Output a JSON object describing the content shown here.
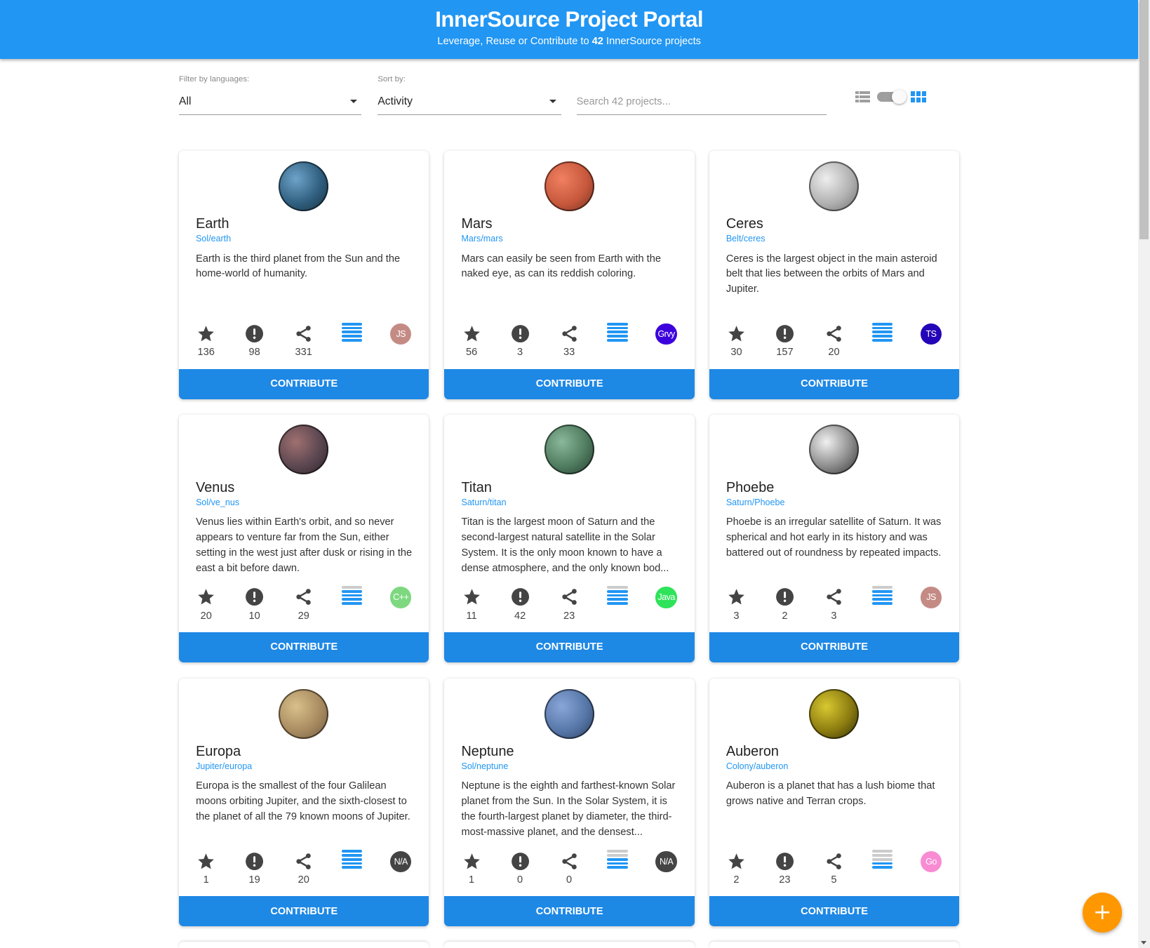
{
  "header": {
    "title": "InnerSource Project Portal",
    "subtitle_pre": "Leverage, Reuse or Contribute to ",
    "subtitle_count": "42",
    "subtitle_post": " InnerSource projects"
  },
  "filters": {
    "language_label": "Filter by languages:",
    "language_value": "All",
    "sort_label": "Sort by:",
    "sort_value": "Activity",
    "search_placeholder": "Search 42 projects..."
  },
  "view_toggle": {
    "list_icon": "list-view-icon",
    "grid_icon": "grid-view-icon",
    "grid_selected": true
  },
  "contribute_label": "CONTRIBUTE",
  "fab_label": "+",
  "colors": {
    "header": "#2196f3",
    "button": "#1e88e5",
    "fab": "#ff9800"
  },
  "projects": [
    {
      "name": "Earth",
      "repo": "Sol/earth",
      "description": "Earth is the third planet from the Sun and the home-world of humanity.",
      "stars": "136",
      "issues": "98",
      "forks": "331",
      "activity": 5,
      "language": "JS",
      "lang_color": "#c48b84",
      "planet": [
        "#6ea3c9",
        "#2f5e7e",
        "#1a2f3a"
      ]
    },
    {
      "name": "Mars",
      "repo": "Mars/mars",
      "description": "Mars can easily be seen from Earth with the naked eye, as can its reddish coloring.",
      "stars": "56",
      "issues": "3",
      "forks": "33",
      "activity": 5,
      "language": "Grvy",
      "lang_color": "#3c00dc",
      "planet": [
        "#f08060",
        "#c8583c",
        "#6a3024"
      ]
    },
    {
      "name": "Ceres",
      "repo": "Belt/ceres",
      "description": "Ceres is the largest object in the main asteroid belt that lies between the orbits of Mars and Jupiter.",
      "stars": "30",
      "issues": "157",
      "forks": "20",
      "activity": 5,
      "language": "TS",
      "lang_color": "#2405b8",
      "planet": [
        "#eeeeee",
        "#b0b0b0",
        "#6a6a6a"
      ]
    },
    {
      "name": "Venus",
      "repo": "Sol/ve_nus",
      "description": "Venus lies within Earth's orbit, and so never appears to venture far from the Sun, either setting in the west just after dusk or rising in the east a bit before dawn.",
      "stars": "20",
      "issues": "10",
      "forks": "29",
      "activity": 4,
      "language": "C++",
      "lang_color": "#7dd87f",
      "planet": [
        "#a07070",
        "#5a4650",
        "#2a2028"
      ]
    },
    {
      "name": "Titan",
      "repo": "Saturn/titan",
      "description": "Titan is the largest moon of Saturn and the second-largest natural satellite in the Solar System. It is the only moon known to have a dense atmosphere, and the only known bod...",
      "stars": "11",
      "issues": "42",
      "forks": "23",
      "activity": 4,
      "language": "Java",
      "lang_color": "#2ee35a",
      "planet": [
        "#8ab89a",
        "#4e7a5e",
        "#25382c"
      ]
    },
    {
      "name": "Phoebe",
      "repo": "Saturn/Phoebe",
      "description": "Phoebe is an irregular satellite of Saturn. It was spherical and hot early in its history and was battered out of roundness by repeated impacts.",
      "stars": "3",
      "issues": "2",
      "forks": "3",
      "activity": 4,
      "language": "JS",
      "lang_color": "#c48b84",
      "planet": [
        "#f0f0f0",
        "#8a8a8a",
        "#2e2e2e"
      ]
    },
    {
      "name": "Europa",
      "repo": "Jupiter/europa",
      "description": "Europa is the smallest of the four Galilean moons orbiting Jupiter, and the sixth-closest to the planet of all the 79 known moons of Jupiter.",
      "stars": "1",
      "issues": "19",
      "forks": "20",
      "activity": 5,
      "language": "N/A",
      "lang_color": "#444444",
      "planet": [
        "#d8c08a",
        "#a88a60",
        "#6a5a40"
      ]
    },
    {
      "name": "Neptune",
      "repo": "Sol/neptune",
      "description": "Neptune is the eighth and farthest-known Solar planet from the Sun. In the Solar System, it is the fourth-largest planet by diameter, the third-most-massive planet, and the densest...",
      "stars": "1",
      "issues": "0",
      "forks": "0",
      "activity": 3,
      "language": "N/A",
      "lang_color": "#444444",
      "planet": [
        "#8aa6d8",
        "#5676a8",
        "#2a3a58"
      ]
    },
    {
      "name": "Auberon",
      "repo": "Colony/auberon",
      "description": "Auberon is a planet that has a lush biome that grows native and Terran crops.",
      "stars": "2",
      "issues": "23",
      "forks": "5",
      "activity": 2,
      "language": "Go",
      "lang_color": "#f98bd3",
      "planet": [
        "#d8c830",
        "#8a7a10",
        "#2a2a08"
      ]
    }
  ]
}
